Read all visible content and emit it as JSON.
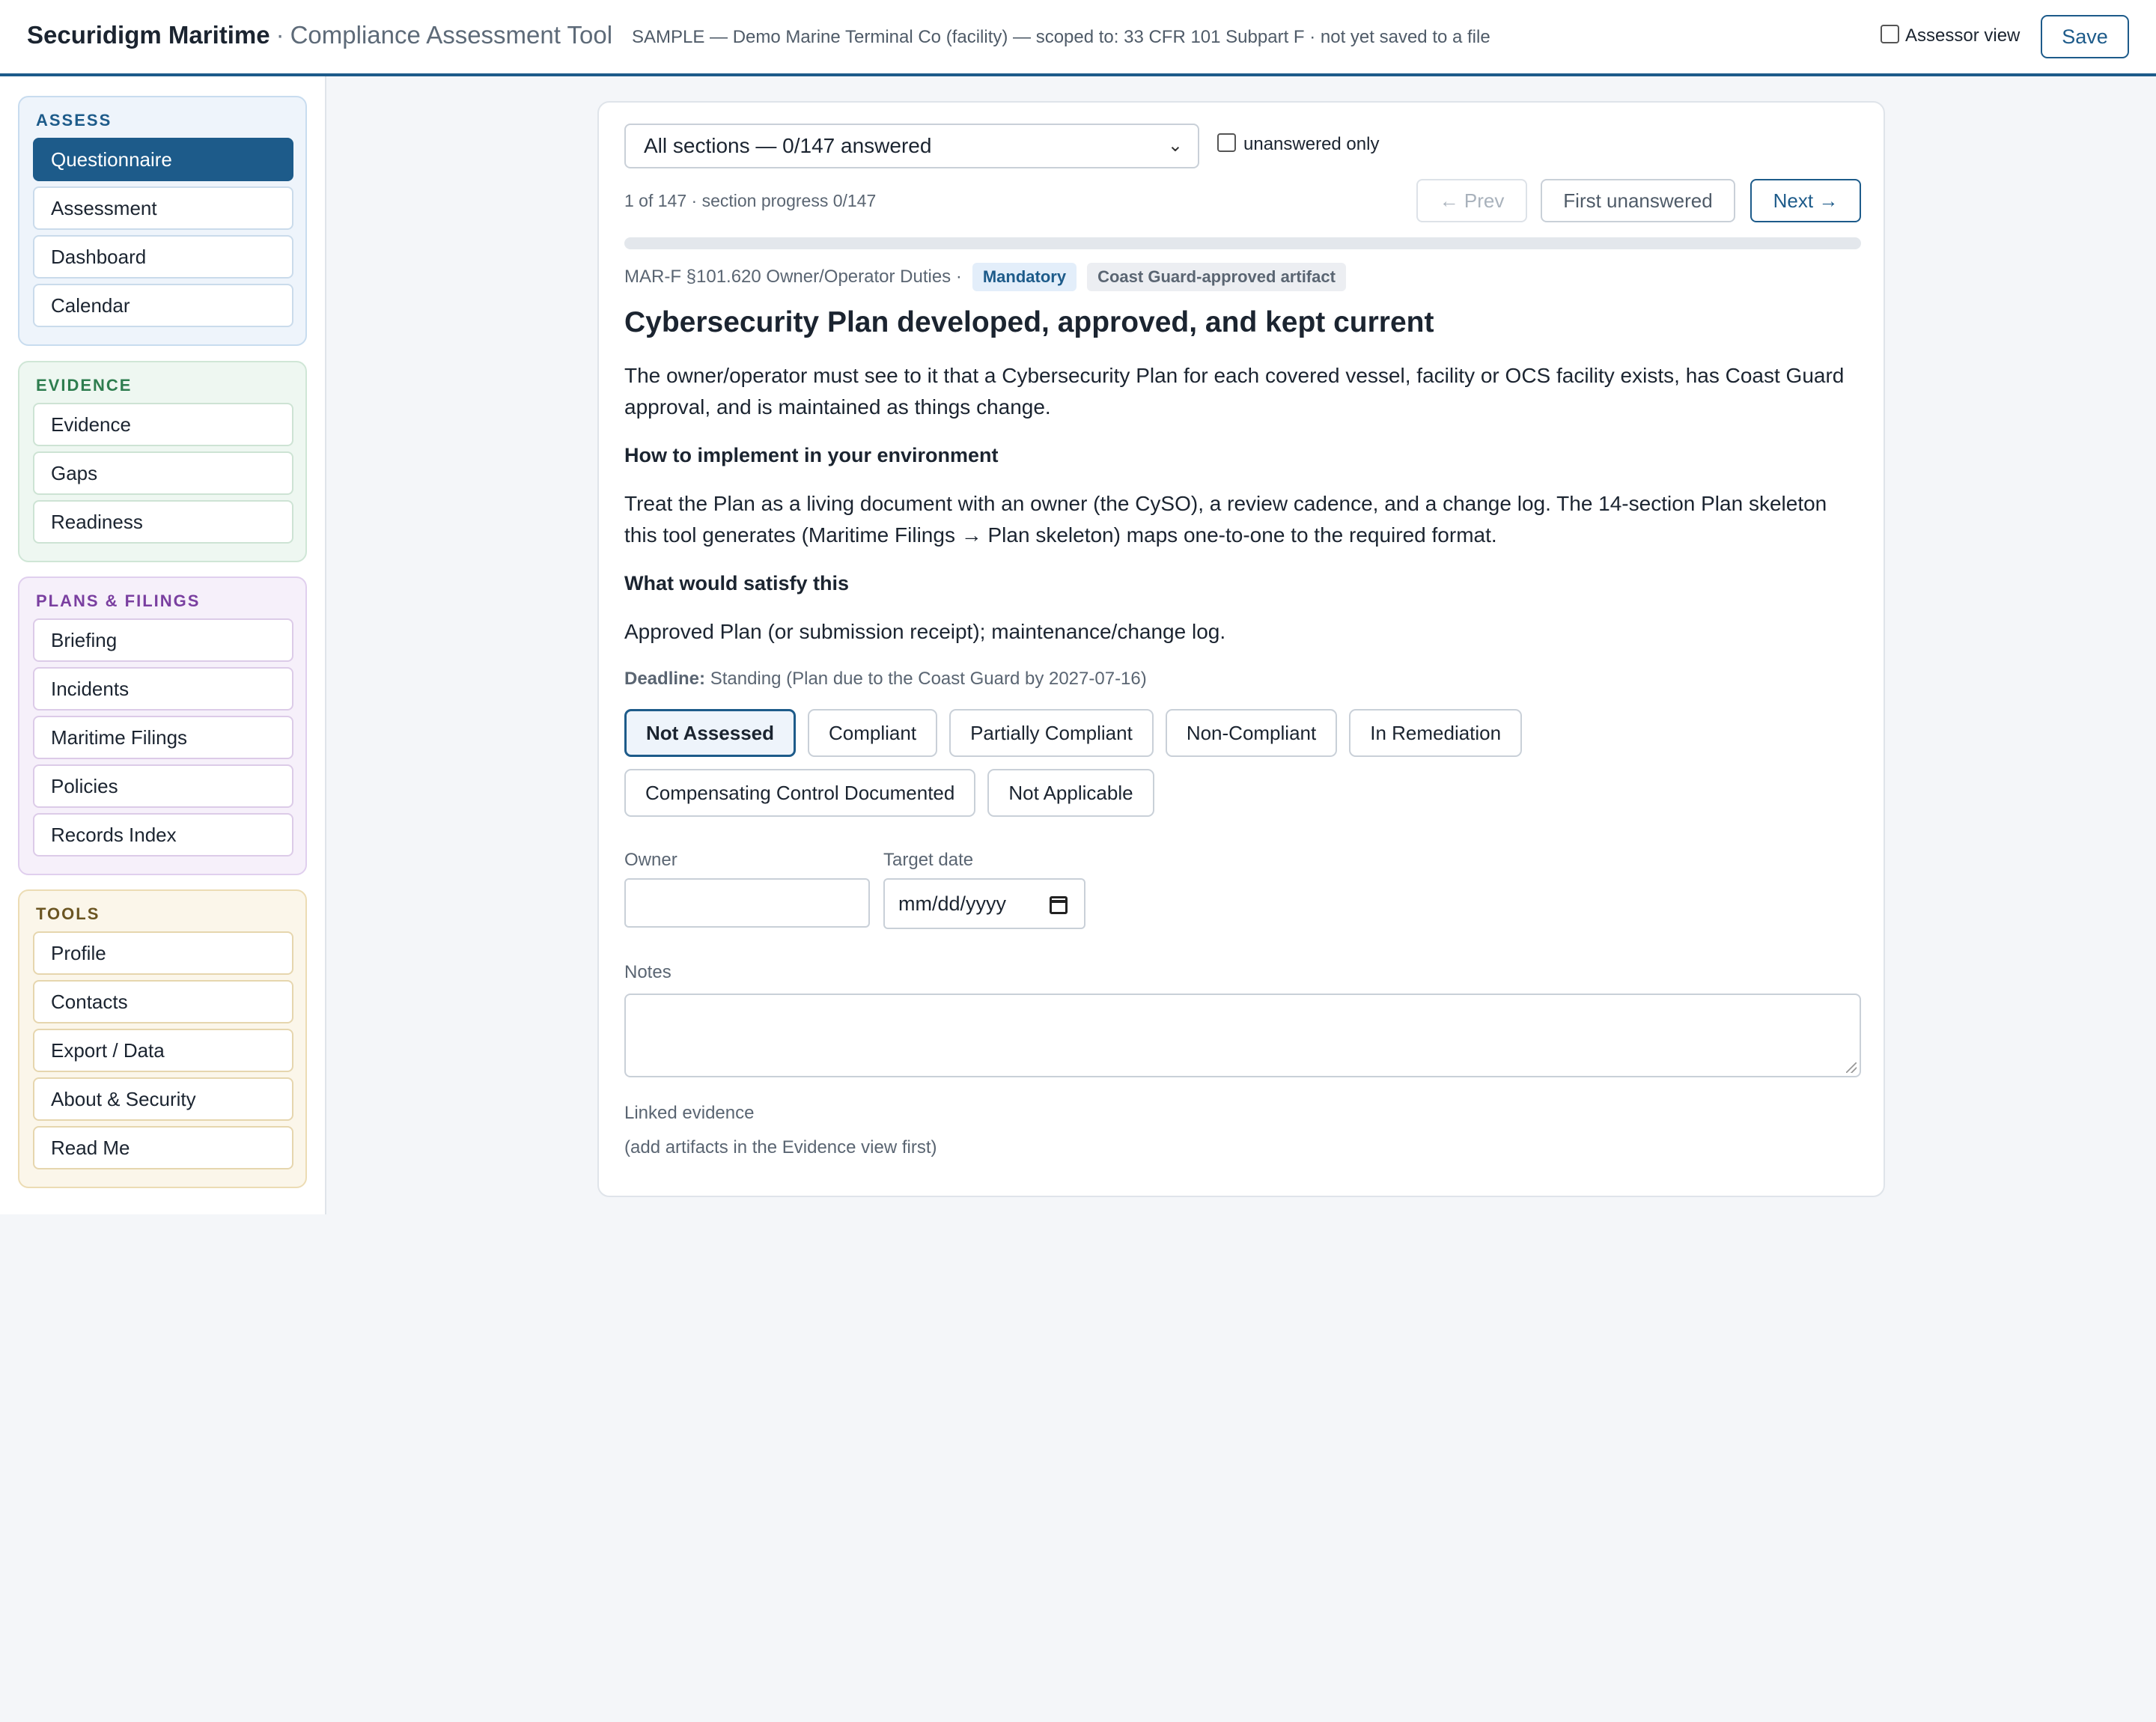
{
  "header": {
    "brand": "Securidigm Maritime",
    "separator": "·",
    "subtitle": "Compliance Assessment Tool",
    "meta": "SAMPLE — Demo Marine Terminal Co (facility) — scoped to: 33 CFR 101 Subpart F · not yet saved to a file",
    "assessor_label": "Assessor view",
    "assessor_checked": false,
    "save_label": "Save"
  },
  "sidebar": {
    "assess": {
      "title": "ASSESS",
      "items": [
        "Questionnaire",
        "Assessment",
        "Dashboard",
        "Calendar"
      ],
      "active": "Questionnaire"
    },
    "evidence": {
      "title": "EVIDENCE",
      "items": [
        "Evidence",
        "Gaps",
        "Readiness"
      ]
    },
    "plans": {
      "title": "PLANS & FILINGS",
      "items": [
        "Briefing",
        "Incidents",
        "Maritime Filings",
        "Policies",
        "Records Index"
      ]
    },
    "tools": {
      "title": "TOOLS",
      "items": [
        "Profile",
        "Contacts",
        "Export / Data",
        "About & Security",
        "Read Me"
      ]
    }
  },
  "questionnaire": {
    "section_select": "All sections — 0/147 answered",
    "unanswered_only_label": "unanswered only",
    "unanswered_only_checked": false,
    "position_text": "1 of 147 · section progress 0/147",
    "progress_fraction": 0,
    "prev_label": "← Prev",
    "first_unanswered_label": "First unanswered",
    "next_label": "Next →",
    "reference": "MAR-F §101.620 Owner/Operator Duties ·",
    "badge_mandatory": "Mandatory",
    "badge_artifact": "Coast Guard-approved artifact",
    "title": "Cybersecurity Plan developed, approved, and kept current",
    "description": "The owner/operator must see to it that a Cybersecurity Plan for each covered vessel, facility or OCS facility exists, has Coast Guard approval, and is maintained as things change.",
    "how_heading": "How to implement in your environment",
    "how_text": "Treat the Plan as a living document with an owner (the CySO), a review cadence, and a change log. The 14-section Plan skeleton this tool generates (Maritime Filings → Plan skeleton) maps one-to-one to the required format.",
    "satisfy_heading": "What would satisfy this",
    "satisfy_text": "Approved Plan (or submission receipt); maintenance/change log.",
    "deadline_label": "Deadline:",
    "deadline_text": "Standing (Plan due to the Coast Guard by 2027-07-16)",
    "statuses": [
      "Not Assessed",
      "Compliant",
      "Partially Compliant",
      "Non-Compliant",
      "In Remediation",
      "Compensating Control Documented",
      "Not Applicable"
    ],
    "selected_status": "Not Assessed",
    "owner_label": "Owner",
    "owner_value": "",
    "target_date_label": "Target date",
    "target_date_placeholder": "mm/dd/yyyy",
    "notes_label": "Notes",
    "notes_value": "",
    "linked_evidence_label": "Linked evidence",
    "linked_evidence_hint": "(add artifacts in the Evidence view first)"
  },
  "colors": {
    "accent": "#1d5b8a",
    "assess": "#1d5b8a",
    "evidence": "#2e7d4f",
    "plans": "#7a3fa0",
    "tools": "#6b5522"
  }
}
